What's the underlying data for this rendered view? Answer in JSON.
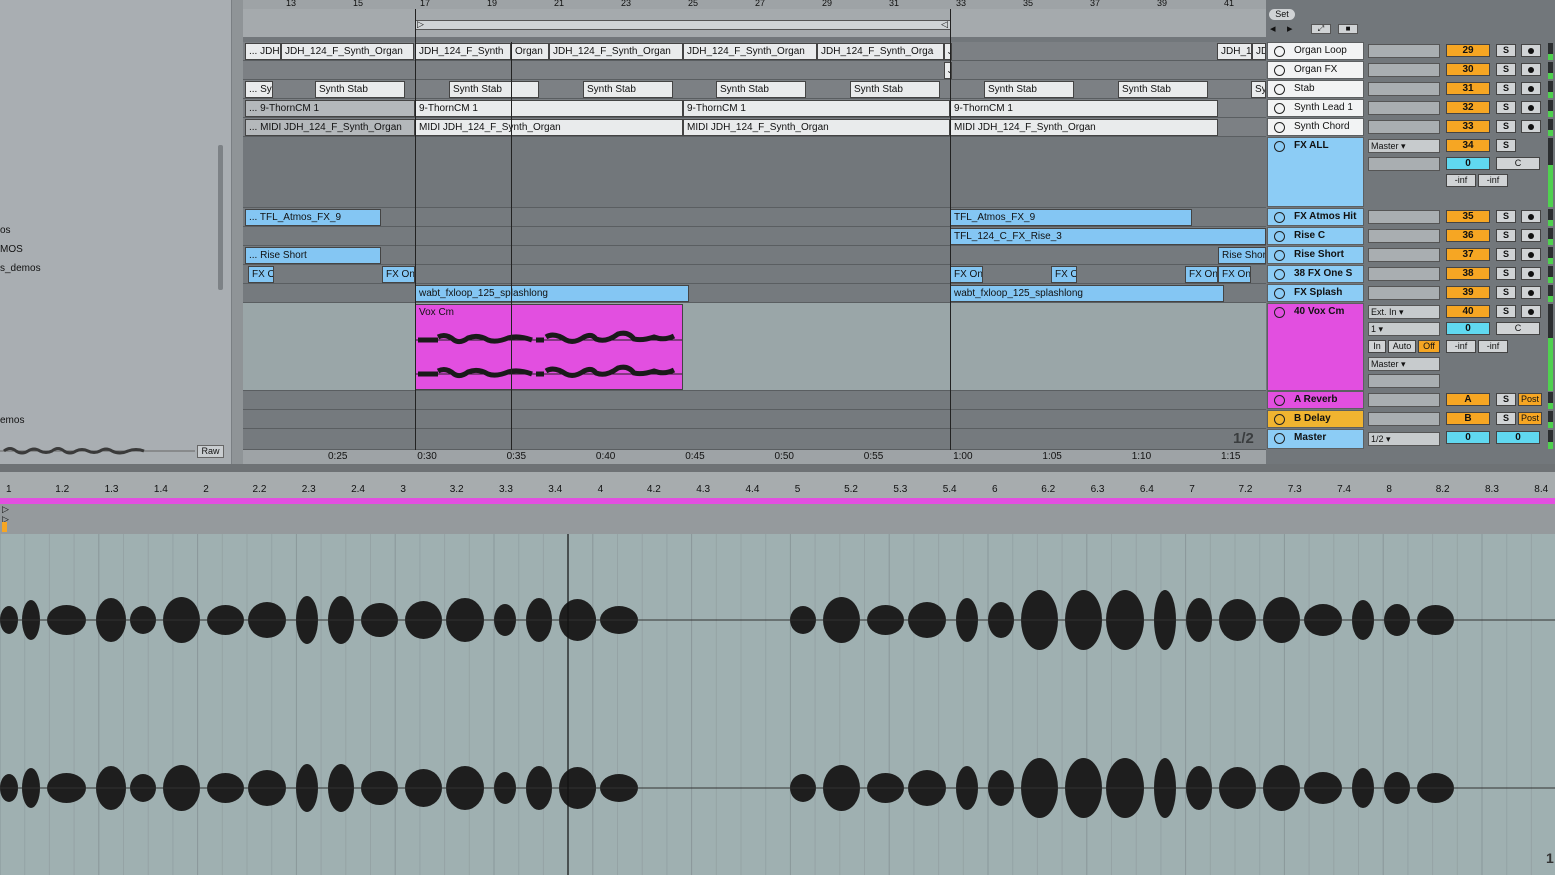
{
  "browser": {
    "items": [
      "os",
      "MOS",
      "s_demos",
      "emos"
    ],
    "raw_label": "Raw"
  },
  "arrangement": {
    "bar_numbers": [
      "13",
      "15",
      "17",
      "19",
      "21",
      "23",
      "25",
      "27",
      "29",
      "31",
      "33",
      "35",
      "37",
      "39",
      "41"
    ],
    "time_labels": [
      "0:25",
      "0:30",
      "0:35",
      "0:40",
      "0:45",
      "0:50",
      "0:55",
      "1:00",
      "1:05",
      "1:10",
      "1:15"
    ],
    "page_indicator": "1/2",
    "set_label": "Set",
    "clips": {
      "organ_loop": [
        "... JDH",
        "JDH_124_F_Synth_Organ",
        "JDH_124_F_Synth",
        "Organ",
        "JDH_124_F_Synth_Organ",
        "JDH_124_F_Synth_Organ",
        "JDH_124_F_Synth_Orga",
        "J",
        "JDH_1",
        "JD"
      ],
      "organ_fx": [
        "J"
      ],
      "stab": [
        "... Sy",
        "Synth Stab",
        "Synth Stab",
        "Synth Stab",
        "Synth Stab",
        "Synth Stab",
        "Synth Stab",
        "Synth Stab",
        "Sy"
      ],
      "synth_lead": [
        "... 9-ThornCM 1",
        "9-ThornCM 1",
        "9-ThornCM 1",
        "9-ThornCM 1"
      ],
      "synth_chord": [
        "... MIDI JDH_124_F_Synth_Organ",
        "MIDI JDH_124_F_Synth_Organ",
        "MIDI JDH_124_F_Synth_Organ",
        "MIDI JDH_124_F_Synth_Organ"
      ],
      "atmos": [
        "... TFL_Atmos_FX_9",
        "TFL_Atmos_FX_9"
      ],
      "rise_c": [
        "TFL_124_C_FX_Rise_3"
      ],
      "rise_short": [
        "... Rise Short",
        "Rise Shor"
      ],
      "fx_one": [
        "FX O",
        "FX On",
        "FX On",
        "FX O",
        "FX On",
        "FX On"
      ],
      "splash": [
        "wabt_fxloop_125_splashlong",
        "wabt_fxloop_125_splashlong"
      ],
      "vox": [
        "Vox Cm"
      ]
    }
  },
  "tracks": [
    {
      "name": "Organ Loop",
      "num": "29"
    },
    {
      "name": "Organ FX",
      "num": "30"
    },
    {
      "name": "Stab",
      "num": "31"
    },
    {
      "name": "Synth Lead 1",
      "num": "32"
    },
    {
      "name": "Synth Chord",
      "num": "33"
    },
    {
      "name": "FX ALL",
      "num": "34"
    },
    {
      "name": "FX Atmos Hit",
      "num": "35"
    },
    {
      "name": "Rise C",
      "num": "36"
    },
    {
      "name": "Rise Short",
      "num": "37"
    },
    {
      "name": "38 FX One S",
      "num": "38"
    },
    {
      "name": "FX Splash",
      "num": "39"
    },
    {
      "name": "40 Vox Cm",
      "num": "40"
    },
    {
      "name": "A Reverb",
      "num": "A"
    },
    {
      "name": "B Delay",
      "num": "B"
    },
    {
      "name": "Master",
      "num": "0"
    }
  ],
  "mixer": {
    "solo": "S",
    "post": "Post",
    "fx_all": {
      "output": "Master",
      "volume": "0",
      "pan": "C",
      "peak_l": "-inf",
      "peak_r": "-inf"
    },
    "vox": {
      "input": "Ext. In",
      "channel": "1",
      "volume": "0",
      "pan": "C",
      "monitor_in": "In",
      "monitor_auto": "Auto",
      "monitor_off": "Off",
      "output": "Master",
      "peak_l": "-inf",
      "peak_r": "-inf"
    },
    "master": {
      "cue": "1/2",
      "volume": "0",
      "pan": "0"
    }
  },
  "detail": {
    "ruler": [
      "1",
      "1.2",
      "1.3",
      "1.4",
      "2",
      "2.2",
      "2.3",
      "2.4",
      "3",
      "3.2",
      "3.3",
      "3.4",
      "4",
      "4.2",
      "4.3",
      "4.4",
      "5",
      "5.2",
      "5.3",
      "5.4",
      "6",
      "6.2",
      "6.3",
      "6.4",
      "7",
      "7.2",
      "7.3",
      "7.4",
      "8",
      "8.2",
      "8.3",
      "8.4"
    ],
    "corner": "1"
  }
}
